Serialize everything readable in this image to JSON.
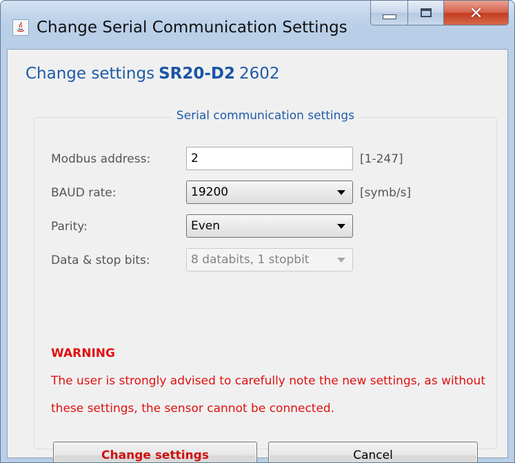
{
  "window": {
    "title": "Change Serial Communication Settings",
    "icon": "java-icon",
    "controls": {
      "minimize": "minimize-icon",
      "maximize": "maximize-icon",
      "close": "✕"
    }
  },
  "heading": {
    "prefix": "Change settings",
    "model": "SR20-D2",
    "serial": "2602"
  },
  "group": {
    "title": "Serial communication settings",
    "modbus": {
      "label": "Modbus address:",
      "value": "2",
      "hint": "[1-247]"
    },
    "baud": {
      "label": "BAUD rate:",
      "value": "19200",
      "hint": "[symb/s]"
    },
    "parity": {
      "label": "Parity:",
      "value": "Even"
    },
    "databits": {
      "label": "Data & stop bits:",
      "value": "8 databits, 1 stopbit"
    }
  },
  "warning": {
    "title": "WARNING",
    "text": "The user is strongly advised to carefully note the new settings, as without these settings, the sensor cannot be connected."
  },
  "buttons": {
    "change": "Change settings",
    "cancel": "Cancel"
  },
  "colors": {
    "heading": "#1f5aa8",
    "warning": "#e01010",
    "window_frame": "#b9cfe8"
  }
}
